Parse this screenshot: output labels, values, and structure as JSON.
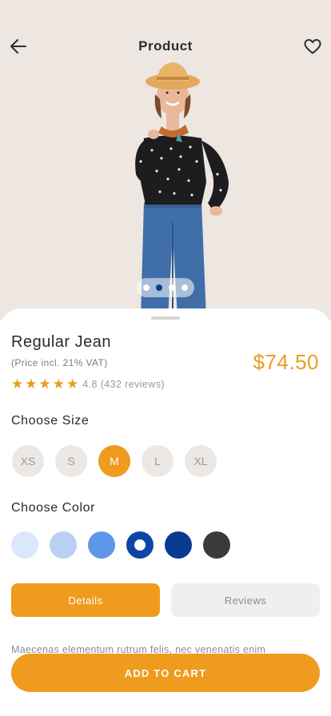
{
  "header": {
    "title": "Product"
  },
  "carousel": {
    "dot_count": 4,
    "active_index": 1
  },
  "product": {
    "name": "Regular Jean",
    "price_note": "(Price incl. 21% VAT)",
    "price": "$74.50",
    "rating_value": 4.8,
    "rating_text": "4.8 (432 reviews)",
    "stars": 5
  },
  "size": {
    "label": "Choose Size",
    "options": [
      "XS",
      "S",
      "M",
      "L",
      "XL"
    ],
    "selected": "M"
  },
  "color": {
    "label": "Choose Color",
    "swatches": [
      "#dbe7fb",
      "#b8d0f1",
      "#5e96e8",
      "#0c46a8",
      "#0a3a92",
      "#3a3a3a"
    ],
    "selected_index": 3
  },
  "tabs": {
    "details": "Details",
    "reviews": "Reviews"
  },
  "description": "Maecenas elementum rutrum felis, nec venenatis enim",
  "cta": {
    "add_to_cart": "ADD TO CART"
  },
  "theme": {
    "accent": "#ee9b1e",
    "hero_bg": "#ede6e1"
  }
}
